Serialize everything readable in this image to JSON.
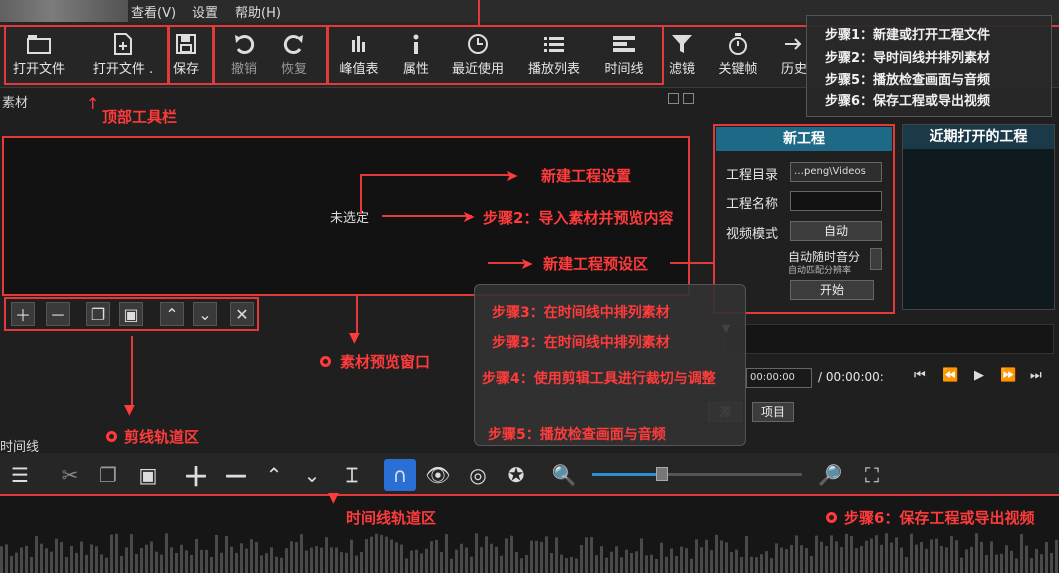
{
  "menu": {
    "items": [
      "查看(V)",
      "设置",
      "帮助(H)"
    ]
  },
  "toolbar": {
    "open_file": "打开文件",
    "open_file_more": "打开文件 .",
    "save": "保存",
    "undo": "撤销",
    "redo": "恢复",
    "peak_meter": "峰值表",
    "properties": "属性",
    "recent": "最近使用",
    "playlist": "播放列表",
    "timeline": "时间线",
    "filters": "滤镜",
    "keyframes": "关键帧",
    "history": "历史"
  },
  "panels": {
    "materials_title": "素材",
    "not_selected": "未选定",
    "timeline_title": "时间线",
    "timecode_current": "00:00:00",
    "timecode_total": "/ 00:00:00:",
    "source_tab": "源",
    "project_tab": "项目"
  },
  "new_project": {
    "title": "新工程",
    "recent_title": "近期打开的工程",
    "dir_label": "工程目录",
    "dir_value": "…peng\\Videos",
    "name_label": "工程名称",
    "video_mode_label": "视频模式",
    "video_mode_value": "自动",
    "auto_res_label": "自动随时音分",
    "auto_res_sub": "自动匹配分辨率",
    "start_button": "开始"
  },
  "annotations": {
    "top_toolbar": "顶部工具栏",
    "new_project_settings": "新建工程设置",
    "step2_import": "步骤2：导入素材并预览内容",
    "new_project_area": "新建工程预设区",
    "clip_preview": "素材预览窗口",
    "clip_track": "剪线轨道区",
    "timeline_track": "时间线轨道区",
    "step6_save": "步骤6：保存工程或导出视频"
  },
  "steps_box": {
    "items": [
      "步骤1：新建或打开工程文件",
      "步骤2：导时间线并排列素材",
      "步骤5：播放检查画面与音频",
      "步骤6：保存工程或导出视频"
    ]
  },
  "popup": {
    "items": [
      "步骤3：在时间线中排列素材",
      "步骤3：在时间线中排列素材",
      "步骤4：使用剪辑工具进行裁切与调整",
      "步骤5：播放检查画面与音频"
    ]
  },
  "colors": {
    "accent_red": "#e23a3a",
    "header_blue": "#1e6a86",
    "snap_blue": "#2a6fd6"
  }
}
